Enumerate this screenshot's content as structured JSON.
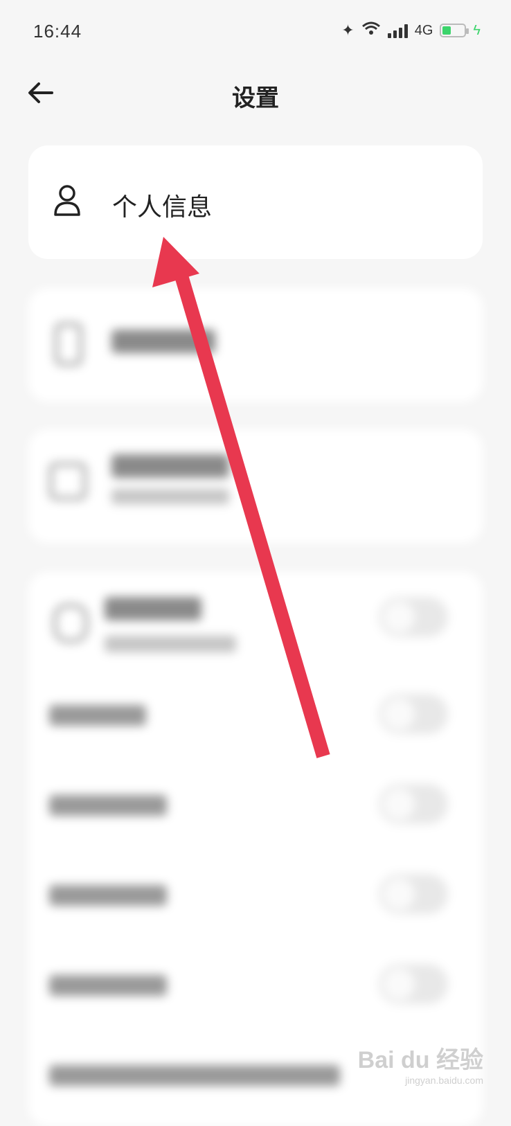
{
  "status_bar": {
    "time": "16:44",
    "network": "4G"
  },
  "header": {
    "title": "设置"
  },
  "items": [
    {
      "label": "个人信息",
      "icon": "person-icon"
    }
  ],
  "watermark": {
    "text": "Bai du 经验",
    "url": "jingyan.baidu.com"
  },
  "colors": {
    "annotation_arrow": "#e8384f",
    "battery": "#3bd46b"
  }
}
